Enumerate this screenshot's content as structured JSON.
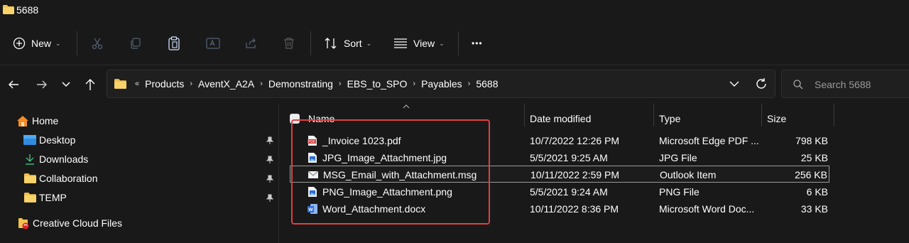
{
  "window": {
    "title": "5688"
  },
  "toolbar": {
    "new_label": "New",
    "sort_label": "Sort",
    "view_label": "View",
    "more_label": "•••"
  },
  "address": {
    "overflow": "«",
    "crumbs": [
      "Products",
      "AventX_A2A",
      "Demonstrating",
      "EBS_to_SPO",
      "Payables",
      "5688"
    ],
    "separator": "›"
  },
  "search": {
    "placeholder": "Search 5688"
  },
  "sidebar": {
    "items": [
      {
        "label": "Home",
        "icon": "home-icon"
      },
      {
        "label": "Desktop",
        "icon": "desktop-icon",
        "pinned": true
      },
      {
        "label": "Downloads",
        "icon": "download-icon",
        "pinned": true
      },
      {
        "label": "Collaboration",
        "icon": "folder-icon",
        "pinned": true
      },
      {
        "label": "TEMP",
        "icon": "folder-icon",
        "pinned": true
      },
      {
        "label": "Creative Cloud Files",
        "icon": "creative-cloud-folder-icon"
      }
    ]
  },
  "columns": {
    "name": "Name",
    "date": "Date modified",
    "type": "Type",
    "size": "Size"
  },
  "files": [
    {
      "name": "_Invoice 1023.pdf",
      "date": "10/7/2022 12:26 PM",
      "type": "Microsoft Edge PDF ...",
      "size": "798 KB",
      "icon": "pdf-icon"
    },
    {
      "name": "JPG_Image_Attachment.jpg",
      "date": "5/5/2021 9:25 AM",
      "type": "JPG File",
      "size": "25 KB",
      "icon": "image-file-icon"
    },
    {
      "name": "MSG_Email_with_Attachment.msg",
      "date": "10/11/2022 2:59 PM",
      "type": "Outlook Item",
      "size": "256 KB",
      "icon": "email-icon",
      "selected": true
    },
    {
      "name": "PNG_Image_Attachment.png",
      "date": "5/5/2021 9:24 AM",
      "type": "PNG File",
      "size": "6 KB",
      "icon": "image-file-icon"
    },
    {
      "name": "Word_Attachment.docx",
      "date": "10/11/2022 8:36 PM",
      "type": "Microsoft Word Doc...",
      "size": "33 KB",
      "icon": "word-doc-icon"
    }
  ],
  "colors": {
    "background": "#191919",
    "highlight": "#e04040",
    "folder": "#f2c14e",
    "pdf": "#d13438",
    "word": "#2b6cd6"
  }
}
